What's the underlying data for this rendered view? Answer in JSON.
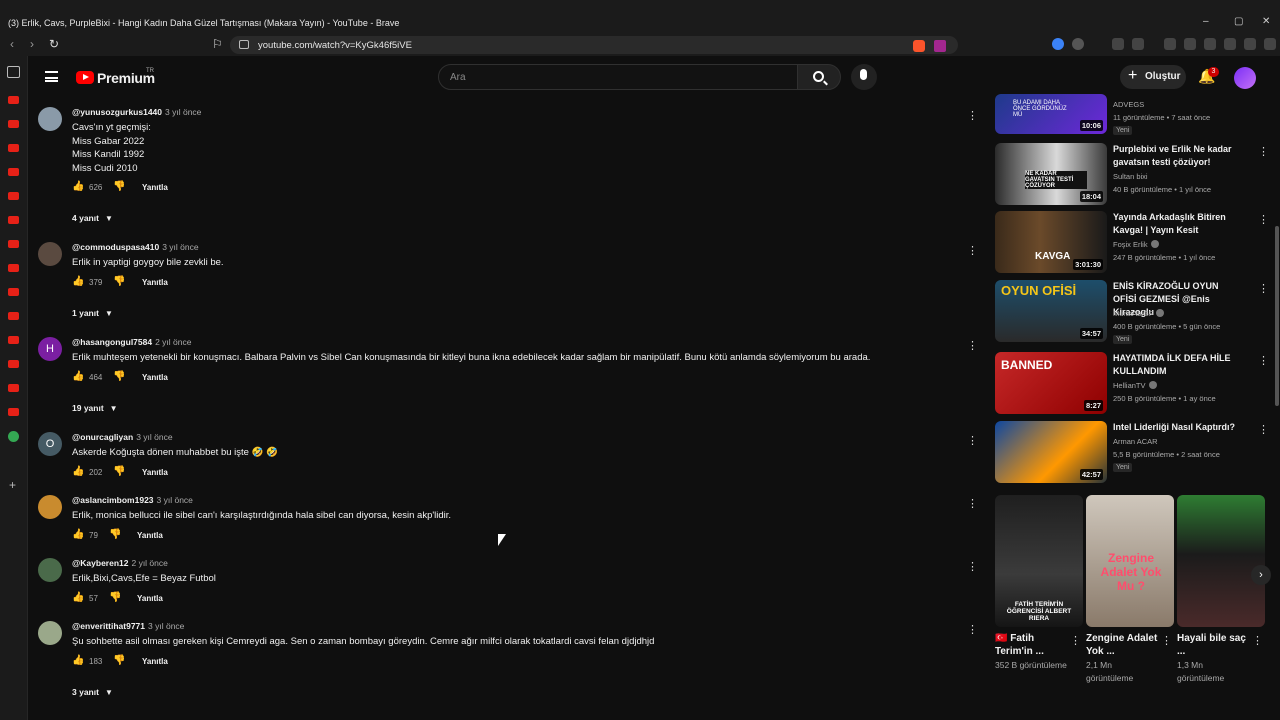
{
  "window": {
    "title": "(3) Erlik, Cavs, PurpleBixi - Hangi Kadın Daha Güzel Tartışması (Makara Yayın) - YouTube - Brave",
    "minimize": "–",
    "maximize": "▢",
    "close": "✕"
  },
  "browser": {
    "back": "‹",
    "forward": "›",
    "reload": "↻",
    "url": "youtube.com/watch?v=KyGk46f5iVE"
  },
  "masthead": {
    "brand": "Premium",
    "brand_suffix": "TR",
    "search_placeholder": "Ara",
    "create_label": "Oluştur",
    "notification_count": "3"
  },
  "colors": {
    "background": "#0f0f0f",
    "brand_red": "#ff0000",
    "badge_red": "#cc0000"
  },
  "comments": [
    {
      "author": "@yunusozgurkus1440",
      "time": "3 yıl önce",
      "text": "Cavs'ın yt geçmişi:\nMiss Gabar 2022\nMiss Kandil 1992\nMiss Cudi 2010",
      "likes": "626",
      "reply": "Yanıtla",
      "replies": "4 yanıt"
    },
    {
      "author": "@commoduspasa410",
      "time": "3 yıl önce",
      "text": "Erlik in yaptigi goygoy bile zevkli be.",
      "likes": "379",
      "reply": "Yanıtla",
      "replies": "1 yanıt"
    },
    {
      "author": "@hasangongul7584",
      "time": "2 yıl önce",
      "text": "Erlik muhteşem yetenekli bir konuşmacı. Balbara Palvin vs Sibel Can konuşmasında bir kitleyi buna ikna edebilecek kadar sağlam bir manipülatif. Bunu kötü anlamda söylemiyorum bu arada.",
      "likes": "464",
      "reply": "Yanıtla",
      "replies": "19 yanıt",
      "avatar_letter": "H"
    },
    {
      "author": "@onurcagliyan",
      "time": "3 yıl önce",
      "text": "Askerde Koğuşta dönen muhabbet bu işte 🤣 🤣",
      "likes": "202",
      "reply": "Yanıtla",
      "avatar_letter": "O"
    },
    {
      "author": "@aslancimbom1923",
      "time": "3 yıl önce",
      "text": "Erlik, monica bellucci ile sibel can'ı karşılaştırdığında hala sibel can diyorsa, kesin akp'lidir.",
      "likes": "79",
      "reply": "Yanıtla"
    },
    {
      "author": "@Kayberen12",
      "time": "2 yıl önce",
      "text": "Erlik,Bixi,Cavs,Efe = Beyaz Futbol",
      "likes": "57",
      "reply": "Yanıtla"
    },
    {
      "author": "@enverittihat9771",
      "time": "3 yıl önce",
      "text": "Şu sohbette asil olması gereken kişi Cemreydi aga. Sen o zaman bombayı göreydin. Cemre ağır milfci olarak tokatlardi cavsi felan djdjdhjd",
      "likes": "183",
      "reply": "Yanıtla",
      "replies": "3 yanıt"
    }
  ],
  "recommendations": [
    {
      "title": "",
      "channel": "ADVEGS",
      "meta": "11 görüntüleme • 7 saat önce",
      "badge": "Yeni",
      "duration": "10:06",
      "thumb_text": "BU ADAMI DAHA ÖNCE GÖRDÜNÜZ MÜ"
    },
    {
      "title": "Purplebixi ve Erlik Ne kadar gavatsın testi çözüyor!",
      "channel": "Sultan bixi",
      "meta": "40 B görüntüleme • 1 yıl önce",
      "duration": "18:04",
      "thumb_text": "NE KADAR GAVATSIN TESTİ ÇÖZÜYOR"
    },
    {
      "title": "Yayında Arkadaşlık Bitiren Kavga! | Yayın Kesit",
      "channel": "Foşix Erlik",
      "meta": "247 B görüntüleme • 1 yıl önce",
      "duration": "3:01:30",
      "thumb_text": "KAVGA"
    },
    {
      "title": "ENİS KİRAZOĞLU OYUN OFİSİ GEZMESİ @Enis Kirazoglu",
      "channel": "MuratAbiGF",
      "meta": "400 B görüntüleme • 5 gün önce",
      "badge": "Yeni",
      "duration": "34:57",
      "thumb_text": "OYUN OFİSİ"
    },
    {
      "title": "HAYATIMDA İLK DEFA HİLE KULLANDIM",
      "channel": "HellianTV",
      "meta": "250 B görüntüleme • 1 ay önce",
      "duration": "8:27",
      "thumb_text": "BANNED"
    },
    {
      "title": "Intel Liderliği Nasıl Kaptırdı?",
      "channel": "Arman ACAR",
      "meta": "5,5 B görüntüleme • 2 saat önce",
      "badge": "Yeni",
      "duration": "42:57"
    }
  ],
  "shorts": [
    {
      "title": "🇹🇷 Fatih Terim'in ...",
      "views": "352 B görüntüleme",
      "thumb_text": "FATİH TERİM'İN ÖĞRENCİSİ ALBERT RIERA"
    },
    {
      "title": "Zengine Adalet Yok ...",
      "views": "2,1 Mn görüntüleme",
      "thumb_text": "Zengine Adalet Yok Mu ?"
    },
    {
      "title": "Hayali bile saç ...",
      "views": "1,3 Mn görüntüleme"
    }
  ],
  "icons": {
    "menu": "⋮",
    "like": "👍",
    "dislike": "👎",
    "chevron": "⌄",
    "bell": "🔔",
    "next": "›",
    "plus": "+"
  }
}
